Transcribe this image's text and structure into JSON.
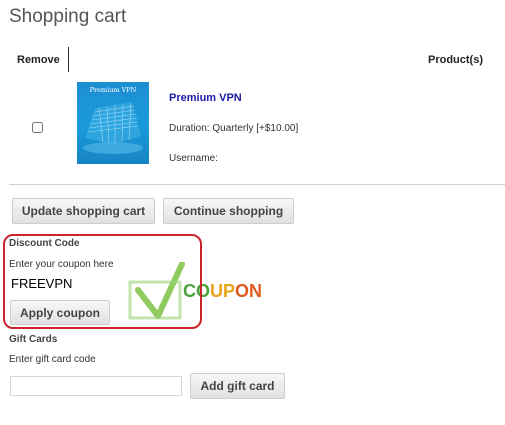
{
  "page": {
    "title": "Shopping cart"
  },
  "cart_table": {
    "headers": {
      "remove": "Remove",
      "products": "Product(s)"
    },
    "items": [
      {
        "image_caption": "Premium VPN",
        "name": "Premium VPN",
        "duration": "Duration: Quarterly [+$10.00]",
        "username": "Username:"
      }
    ]
  },
  "actions": {
    "update_cart": "Update shopping cart",
    "continue_shopping": "Continue shopping"
  },
  "discount": {
    "label": "Discount Code",
    "helper": "Enter your coupon here",
    "value": "FREEVPN",
    "apply": "Apply coupon"
  },
  "watermark": {
    "letters": [
      "C",
      "O",
      "U",
      "P",
      "O",
      "N"
    ],
    "colors": [
      "#4aa03a",
      "#4aa03a",
      "#e8a21b",
      "#e8a21b",
      "#e05a1e",
      "#e05a1e"
    ]
  },
  "gift": {
    "label": "Gift Cards",
    "helper": "Enter gift card code",
    "value": "",
    "add": "Add gift card"
  },
  "colors": {
    "product_link": "#1a1aa6",
    "highlight": "#c9252b",
    "check_green": "#7cc244"
  }
}
